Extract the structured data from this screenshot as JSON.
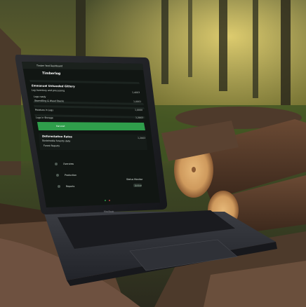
{
  "screen": {
    "tab_title": "Timber Yard Dashboard",
    "page_title": "Timberlog",
    "sections": [
      {
        "heading": "Emmanuel Unhanded Gittery",
        "sub": "Log Inventory and processing",
        "items": [
          {
            "label": "Logs ready",
            "value": "1,4003"
          },
          {
            "label": "Sawmilling & Wood Stacks",
            "value": "1,0001"
          },
          {
            "label": "Moisture in Logs",
            "value": "1,0000"
          },
          {
            "label": "Logs in Storage",
            "value": "1,2003"
          }
        ],
        "button": "Harvest"
      },
      {
        "heading": "Deforestation Rates",
        "sub": "Sustainable forestry data",
        "items": [
          {
            "label": "Forest Reports",
            "value": "1,2003"
          }
        ]
      }
    ],
    "sidebar": [
      {
        "label": "Overview"
      },
      {
        "label": "Production"
      },
      {
        "label": "Reports"
      }
    ],
    "footer": {
      "label": "Status Monitor",
      "value": "Active"
    }
  },
  "keyboard": {
    "brand": "MacBook"
  },
  "colors": {
    "accent": "#2f9e4b",
    "screen_bg": "#111613"
  }
}
